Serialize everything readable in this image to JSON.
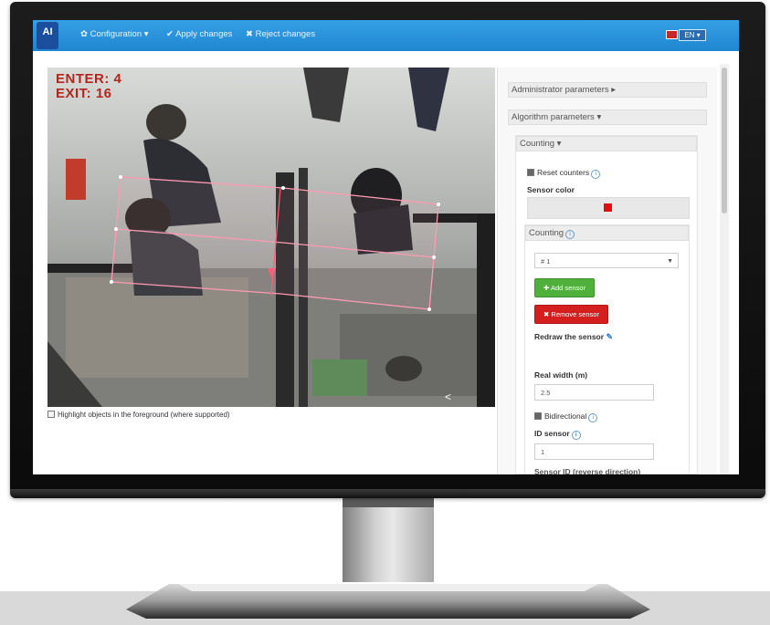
{
  "nav": {
    "logo": "AI",
    "configuration": "✿ Configuration ▾",
    "apply": "✔ Apply changes",
    "reject": "✖ Reject changes",
    "language": "EN ▾"
  },
  "video": {
    "enter_label": "ENTER: 4",
    "exit_label": "EXIT: 16",
    "highlight_label": "Highlight objects in the foreground (where supported)"
  },
  "panel": {
    "admin_params": "Administrator parameters ▸",
    "algo_params": "Algorithm parameters ▾",
    "counting_header": "Counting ▾",
    "reset_counters": "Reset counters",
    "sensor_color_label": "Sensor color",
    "sensor_color": "#e01010",
    "counting_sub": "Counting",
    "sensor_select": "# 1",
    "add_sensor": "✚ Add sensor",
    "remove_sensor": "✖ Remove sensor",
    "redraw_sensor": "Redraw the sensor",
    "real_width_label": "Real width (m)",
    "real_width_value": "2.5",
    "bidirectional": "Bidirectional",
    "id_sensor_label": "ID sensor",
    "id_sensor_value": "1",
    "sensor_id_reverse": "Sensor ID (reverse direction)"
  }
}
